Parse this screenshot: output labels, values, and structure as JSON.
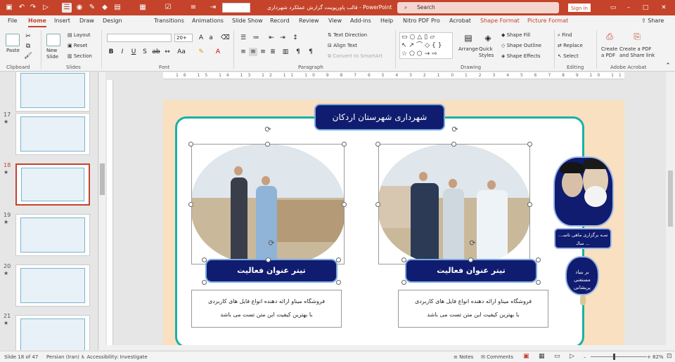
{
  "titlebar": {
    "document_title": "قالب پاورپوینت گزارش عملکرد شهرداری - PowerPoint",
    "search_placeholder": "Search",
    "signin_label": "Sign in",
    "font_name_value": ""
  },
  "tabs": [
    "File",
    "Home",
    "Insert",
    "Draw",
    "Design",
    "Transitions",
    "Animations",
    "Slide Show",
    "Record",
    "Review",
    "View",
    "Add-ins",
    "Help",
    "Nitro PDF Pro",
    "Acrobat",
    "Shape Format",
    "Picture Format"
  ],
  "share_label": "Share",
  "ribbon": {
    "clipboard": {
      "paste": "Paste",
      "group": "Clipboard"
    },
    "slides": {
      "new_slide": "New Slide",
      "layout": "Layout",
      "reset": "Reset",
      "section": "Section",
      "group": "Slides"
    },
    "font": {
      "size": "20+",
      "group": "Font"
    },
    "paragraph": {
      "text_direction": "Text Direction",
      "align_text": "Align Text",
      "smartart": "Convert to SmartArt",
      "group": "Paragraph"
    },
    "drawing": {
      "arrange": "Arrange",
      "quick_styles": "Quick Styles",
      "shape_fill": "Shape Fill",
      "shape_outline": "Shape Outline",
      "shape_effects": "Shape Effects",
      "group": "Drawing"
    },
    "editing": {
      "find": "Find",
      "replace": "Replace",
      "select": "Select",
      "group": "Editing"
    },
    "acrobat": {
      "create_pdf": "Create a PDF",
      "create_share": "Create a PDF and Share link",
      "group": "Adobe Acrobat"
    }
  },
  "thumbnails": [
    {
      "num": "",
      "star": ""
    },
    {
      "num": "17",
      "star": "★"
    },
    {
      "num": "18",
      "star": "★"
    },
    {
      "num": "19",
      "star": "★"
    },
    {
      "num": "20",
      "star": "★"
    },
    {
      "num": "21",
      "star": "★"
    }
  ],
  "ruler_text": "16 15 14 13 12 11 10 9 8 7 6 5 4 3 2 1 0 1 2 3 4 5 6 7 8 9 10 11 12 13 14 15 16",
  "slide": {
    "banner": "شهرداری شهرستان اردکان",
    "left_card": {
      "title": "تیتر عنوان فعالیت",
      "line1": "فروشگاه میناو ارائه دهنده انواع فایل های کاربردی",
      "line2": "با بهترین کیفیت این متن تست می باشد"
    },
    "right_card": {
      "title": "تیتر عنوان فعالیت",
      "line1": "فروشگاه میناو ارائه دهنده انواع فایل های کاربردی",
      "line2": "با بهترین کیفیت این متن تست می باشد"
    },
    "slogan": "سـه برگزاری ماهی تاسـ... سالـ ...",
    "badge": "بر بنیاد مستغنی پریشانی"
  },
  "status": {
    "slide_of": "Slide 18 of 47",
    "language": "Persian (Iran)",
    "accessibility": "Accessibility: Investigate",
    "notes": "Notes",
    "comments": "Comments",
    "zoom": "82%"
  },
  "colors": {
    "brand": "#c4432a",
    "slide_navy": "#0f1c6f",
    "frame_teal": "#1ab0a3",
    "slide_bg": "#f8e0c0"
  }
}
